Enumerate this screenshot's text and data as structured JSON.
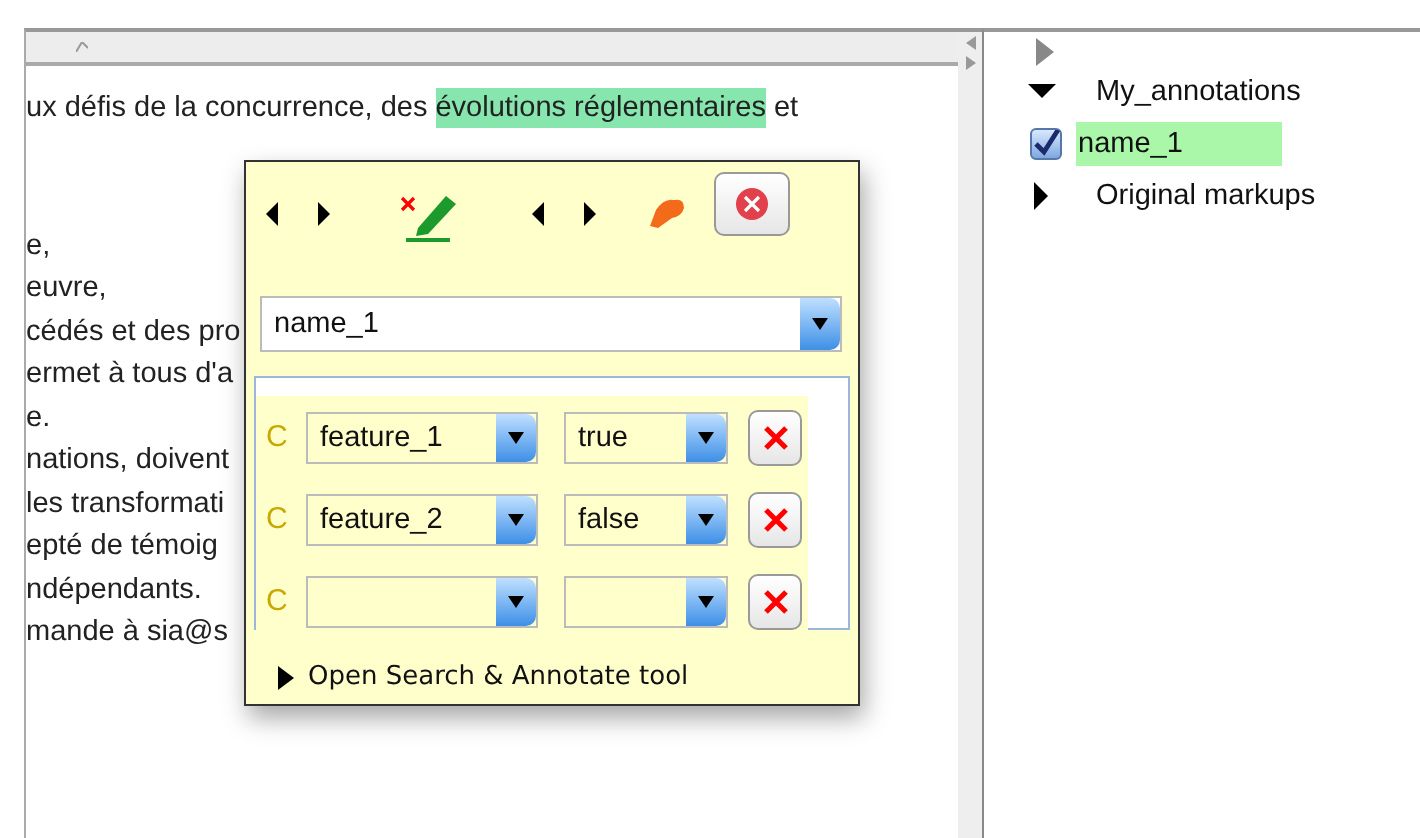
{
  "document": {
    "first_line": [
      {
        "text": "ux défis de la concurrence, des ",
        "highlighted": false
      },
      {
        "text": "évolutions réglementaires",
        "highlighted": true
      },
      {
        "text": " et",
        "highlighted": false
      }
    ],
    "lines": [
      "e,",
      "euvre,",
      "cédés et des pro",
      "ermet à tous d'a",
      "e.",
      "nations, doivent",
      "les transformati",
      "epté de témoig",
      "ndépendants.",
      "mande à sia@s"
    ]
  },
  "popup": {
    "annotation": "name_1",
    "features": [
      {
        "marker": "C",
        "name": "feature_1",
        "value": "true"
      },
      {
        "marker": "C",
        "name": "feature_2",
        "value": "false"
      },
      {
        "marker": "C"
      }
    ],
    "footer": {
      "label": "Open Search & Annotate tool",
      "expanded": false
    }
  },
  "tree": {
    "items": [
      {
        "label": "My_annotations",
        "expanded": true,
        "children": [
          {
            "label": "name_1",
            "checked": true,
            "selected": true
          }
        ]
      },
      {
        "label": "Original markups",
        "expanded": false
      }
    ]
  }
}
